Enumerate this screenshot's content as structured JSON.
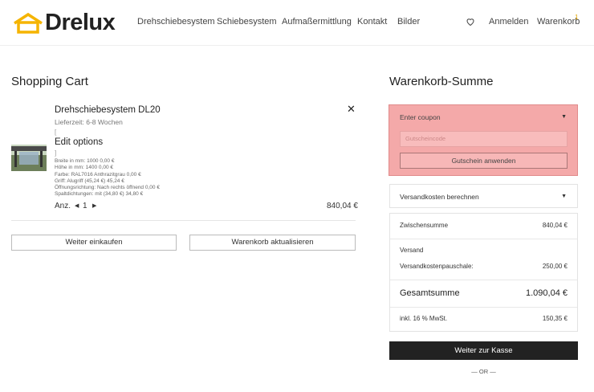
{
  "header": {
    "logo_text": "Drelux",
    "nav": [
      "Drehschiebesystem",
      "Schiebesystem",
      "Aufmaßermittlung",
      "Kontakt",
      "Bilder"
    ],
    "login": "Anmelden",
    "cart": "Warenkorb",
    "cart_count": "1",
    "brand_color": "#f5b400"
  },
  "cart": {
    "title": "Shopping Cart",
    "item": {
      "name": "Drehschiebesystem DL20",
      "delivery": "Lieferzeit: 6-8 Wochen",
      "bracket": "[",
      "edit_label": "Edit options",
      "bracket_close": "]",
      "options": [
        "Breite in mm:  1000 0,00 €",
        "Höhe in mm:  1400 0,00 €",
        "Farbe:  RAL7016 Anthrazitgrau 0,00 €",
        "Griff:  Alugriff (45,24 €) 45,24 €",
        "Öffnungsrichtung:  Nach rechts öffnend 0,00 €",
        "Spaltdichtungen:  mit (34,80 €) 34,80 €"
      ],
      "qty_label": "Anz.",
      "qty": "1",
      "total": "840,04 €"
    },
    "continue_label": "Weiter einkaufen",
    "update_label": "Warenkorb aktualisieren"
  },
  "summary": {
    "title": "Warenkorb-Summe",
    "coupon": {
      "title": "Enter coupon",
      "placeholder": "Gutscheincode",
      "apply_label": "Gutschein anwenden"
    },
    "shipping_calc": "Versandkosten berechnen",
    "subtotal_label": "Zwischensumme",
    "subtotal": "840,04 €",
    "shipping_label": "Versand",
    "shipping_flat_label": "Versandkostenpauschale:",
    "shipping_flat": "250,00 €",
    "total_label": "Gesamtsumme",
    "total": "1.090,04 €",
    "tax_label": "inkl. 16 % MwSt.",
    "tax": "150,35 €",
    "checkout_label": "Weiter zur Kasse",
    "or_text": "— OR —"
  }
}
